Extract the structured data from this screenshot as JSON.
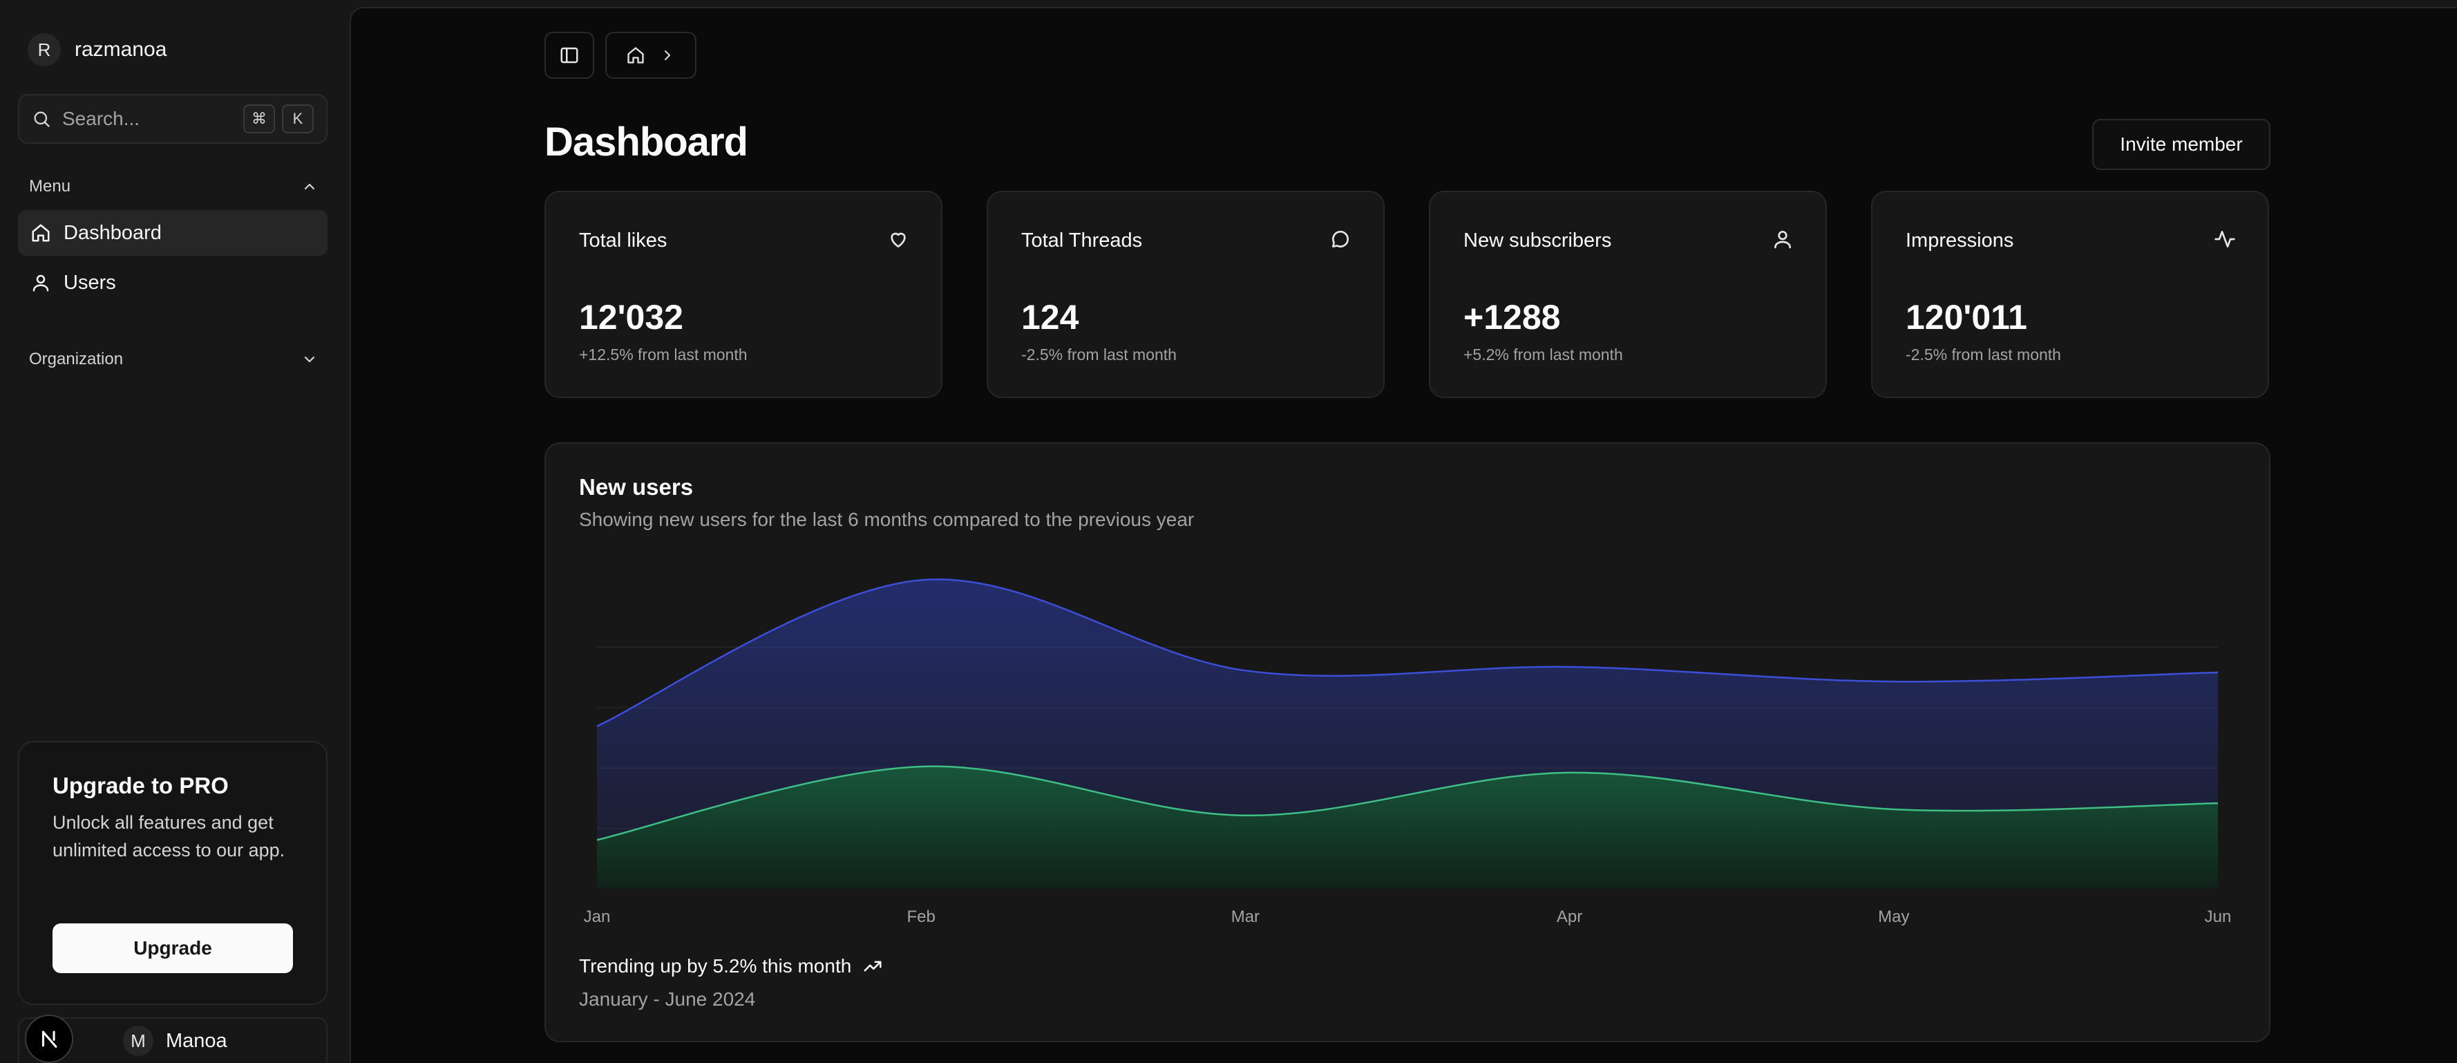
{
  "sidebar": {
    "user": {
      "initial": "R",
      "name": "razmanoa"
    },
    "search": {
      "placeholder": "Search...",
      "shortcut_cmd": "⌘",
      "shortcut_key": "K"
    },
    "menu_label": "Menu",
    "items": [
      {
        "label": "Dashboard",
        "icon": "home-icon",
        "active": true
      },
      {
        "label": "Users",
        "icon": "user-icon",
        "active": false
      }
    ],
    "organization_label": "Organization",
    "upgrade": {
      "title": "Upgrade to PRO",
      "text": "Unlock all features and get unlimited access to our app.",
      "button": "Upgrade"
    },
    "bottom_user": {
      "initial": "M",
      "name": "Manoa"
    },
    "badge": "N"
  },
  "header": {
    "title": "Dashboard",
    "invite_button": "Invite member"
  },
  "stats": [
    {
      "label": "Total likes",
      "value": "12'032",
      "delta": "+12.5% from last month",
      "icon": "heart-icon"
    },
    {
      "label": "Total Threads",
      "value": "124",
      "delta": "-2.5% from last month",
      "icon": "message-circle-icon"
    },
    {
      "label": "New subscribers",
      "value": "+1288",
      "delta": "+5.2% from last month",
      "icon": "user-icon"
    },
    {
      "label": "Impressions",
      "value": "120'011",
      "delta": "-2.5% from last month",
      "icon": "activity-icon"
    }
  ],
  "chart": {
    "title": "New users",
    "subtitle": "Showing new users for the last 6 months compared to the previous year",
    "trend_text": "Trending up by 5.2% this month",
    "range_text": "January - June 2024"
  },
  "chart_data": {
    "type": "area",
    "categories": [
      "Jan",
      "Feb",
      "Mar",
      "Apr",
      "May",
      "Jun"
    ],
    "series": [
      {
        "values": [
          186,
          305,
          237,
          173,
          209,
          214
        ],
        "color": "#2f3fb0"
      },
      {
        "values": [
          80,
          200,
          120,
          190,
          130,
          140
        ],
        "color": "#22a06b"
      }
    ],
    "stacked": true,
    "ylim": [
      0,
      520
    ],
    "grid": true,
    "colors": {
      "accent": "#fafafa",
      "muted": "#a3a3a3",
      "border": "#262626"
    }
  }
}
